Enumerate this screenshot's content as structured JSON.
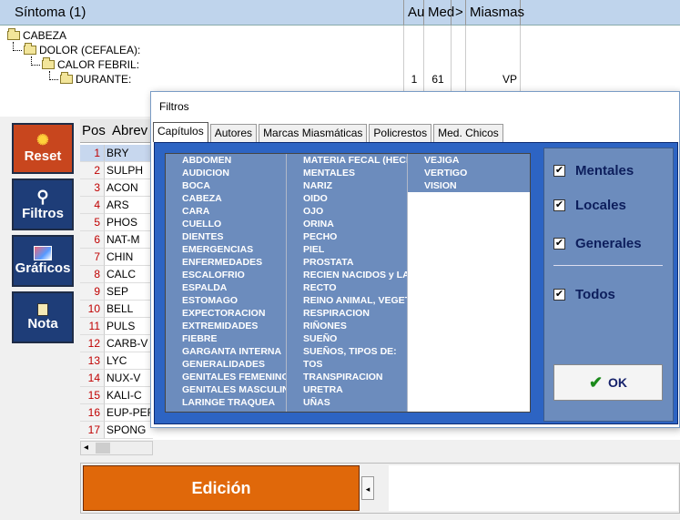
{
  "symptom_grid": {
    "headers": {
      "sintoma": "Síntoma (1)",
      "au": "Au",
      "med": "Med",
      "gt": ">",
      "miasmas": "Miasmas"
    },
    "tree": [
      "CABEZA",
      "DOLOR (CEFALEA):",
      "CALOR FEBRIL:",
      "DURANTE:"
    ],
    "last_row": {
      "au": "1",
      "med": "61",
      "miasmas": "VP"
    }
  },
  "sidebar": {
    "reset": {
      "label": "Reset",
      "color": "#c8461e"
    },
    "filtros": {
      "label": "Filtros",
      "color": "#1e3d78"
    },
    "graficos": {
      "label": "Gráficos",
      "color": "#1e3d78"
    },
    "nota": {
      "label": "Nota",
      "color": "#1e3d78"
    }
  },
  "remedies": {
    "headers": {
      "pos": "Pos",
      "abrev": "Abrev"
    },
    "rows": [
      {
        "pos": "1",
        "abr": "BRY"
      },
      {
        "pos": "2",
        "abr": "SULPH"
      },
      {
        "pos": "3",
        "abr": "ACON"
      },
      {
        "pos": "4",
        "abr": "ARS"
      },
      {
        "pos": "5",
        "abr": "PHOS"
      },
      {
        "pos": "6",
        "abr": "NAT-M"
      },
      {
        "pos": "7",
        "abr": "CHIN"
      },
      {
        "pos": "8",
        "abr": "CALC"
      },
      {
        "pos": "9",
        "abr": "SEP"
      },
      {
        "pos": "10",
        "abr": "BELL"
      },
      {
        "pos": "11",
        "abr": "PULS"
      },
      {
        "pos": "12",
        "abr": "CARB-V"
      },
      {
        "pos": "13",
        "abr": "LYC"
      },
      {
        "pos": "14",
        "abr": "NUX-V"
      },
      {
        "pos": "15",
        "abr": "KALI-C"
      },
      {
        "pos": "16",
        "abr": "EUP-PER"
      },
      {
        "pos": "17",
        "abr": "SPONG"
      }
    ]
  },
  "edit": {
    "label": "Edición"
  },
  "filtros_dialog": {
    "title": "Filtros",
    "tabs": [
      "Capítulos",
      "Autores",
      "Marcas Miasmáticas",
      "Policrestos",
      "Med. Chicos"
    ],
    "chapters_col1": [
      "ABDOMEN",
      "AUDICION",
      "BOCA",
      "CABEZA",
      "CARA",
      "CUELLO",
      "DIENTES",
      "EMERGENCIAS",
      "ENFERMEDADES",
      "ESCALOFRIO",
      "ESPALDA",
      "ESTOMAGO",
      "EXPECTORACION",
      "EXTREMIDADES",
      "FIEBRE",
      "GARGANTA INTERNA",
      "GENERALIDADES",
      "GENITALES FEMENINOS",
      "GENITALES  MASCULINOS",
      "LARINGE TRAQUEA"
    ],
    "chapters_col2": [
      "MATERIA FECAL (HECES)",
      "MENTALES",
      "NARIZ",
      "OIDO",
      "OJO",
      "ORINA",
      "PECHO",
      "PIEL",
      "PROSTATA",
      "RECIEN NACIDOS y LACTANTES",
      "RECTO",
      "REINO ANIMAL, VEGETAL",
      "RESPIRACION",
      "RIÑONES",
      "SUEÑO",
      "SUEÑOS, TIPOS DE:",
      "TOS",
      "TRANSPIRACION",
      "URETRA",
      "UÑAS"
    ],
    "chapters_col3": [
      "VEJIGA",
      "VERTIGO",
      "VISION"
    ],
    "checks": {
      "mentales": "Mentales",
      "locales": "Locales",
      "generales": "Generales",
      "todos": "Todos"
    },
    "ok": "OK"
  }
}
